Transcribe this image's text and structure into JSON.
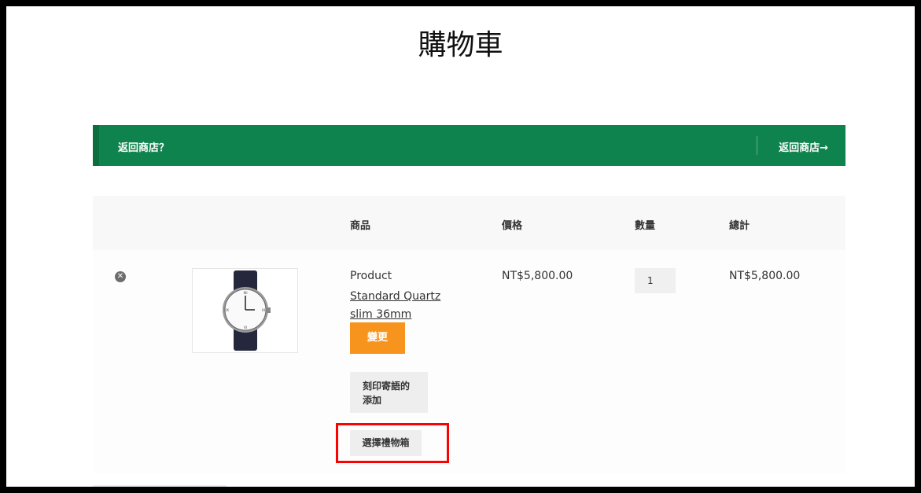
{
  "page": {
    "title": "購物車"
  },
  "notice": {
    "message": "返回商店？",
    "button_label": "返回商店→",
    "background_color": "#0f834d"
  },
  "cart_table": {
    "headers": [
      "",
      "",
      "商品",
      "價格",
      "數量",
      "總計"
    ],
    "rows": [
      {
        "remove_icon": "remove-circle-icon",
        "product_prefix": "Product",
        "product_name": "Standard Quartz slim 36mm",
        "change_label": "變更",
        "engrave_label": "刻印寄語的添加",
        "giftbox_label": "選擇禮物箱",
        "price": "NT$5,800.00",
        "quantity": "1",
        "subtotal": "NT$5,800.00"
      }
    ]
  },
  "colors": {
    "accent_orange": "#f7941d",
    "highlight_red": "#ff0000"
  }
}
